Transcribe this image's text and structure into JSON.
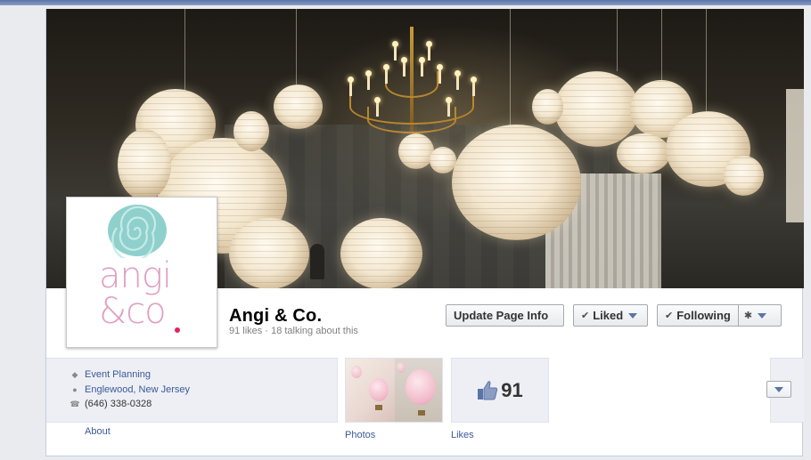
{
  "page": {
    "name": "Angi & Co.",
    "stats": "91 likes · 18 talking about this"
  },
  "profile": {
    "logo_text_line1": "angi",
    "logo_text_line2": "&co",
    "logo_colors": {
      "swirl": "#7fc7c4",
      "text": "#e0a0c0",
      "dot": "#e0245e"
    }
  },
  "actions": {
    "update_label": "Update Page Info",
    "liked_label": "Liked",
    "following_label": "Following"
  },
  "about": {
    "category": "Event Planning",
    "location": "Englewood, New Jersey",
    "phone": "(646) 338-0328",
    "label": "About"
  },
  "apps": {
    "photos_label": "Photos",
    "likes_label": "Likes",
    "likes_count": "91"
  },
  "icons": {
    "category": "tag-icon",
    "location": "map-pin-icon",
    "phone": "phone-icon",
    "settings": "gear-icon",
    "liked": "check-icon",
    "likes": "thumbs-up-icon",
    "more": "chevron-down-icon"
  },
  "colors": {
    "link": "#3b5998",
    "accent": "#5b74a8"
  }
}
